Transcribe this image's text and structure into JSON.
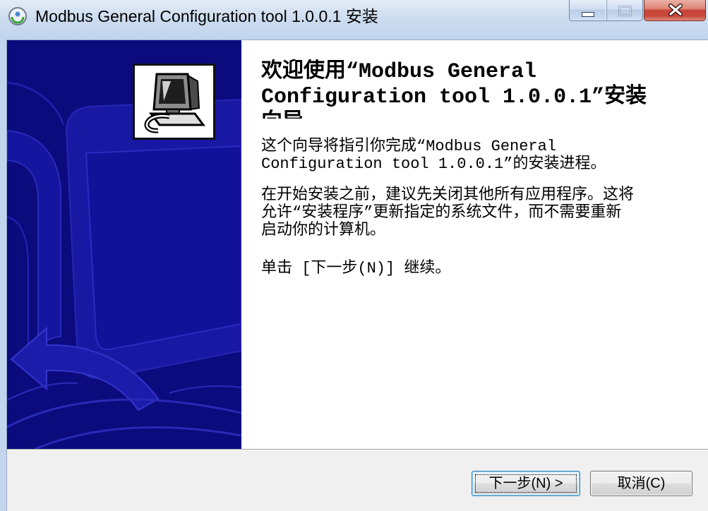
{
  "window": {
    "title": "Modbus General Configuration tool 1.0.0.1 安装",
    "icon": "installer-icon",
    "controls": {
      "minimize": "minimize-icon",
      "maximize": "maximize-icon",
      "close": "close-icon"
    },
    "maximize_enabled": false
  },
  "sidebar": {
    "icon": "computer-setup-icon"
  },
  "welcome": {
    "heading_lines": [
      "欢迎使用“Modbus General",
      "Configuration tool 1.0.0.1”安装",
      "向导"
    ],
    "paragraphs": [
      [
        "这个向导将指引你完成“Modbus General",
        "Configuration tool 1.0.0.1”的安装进程。"
      ],
      [
        "在开始安装之前，建议先关闭其他所有应用程序。这将",
        "允许“安装程序”更新指定的系统文件，而不需要重新",
        "启动你的计算机。"
      ],
      [
        "单击 [下一步(N)] 继续。"
      ]
    ]
  },
  "buttons": {
    "next": {
      "label": "下一步(N) >",
      "is_default": true,
      "focused": true
    },
    "cancel": {
      "label": "取消(C)"
    }
  },
  "colors": {
    "frame": "#c2d5ed",
    "title_bar": "#c0d4ec",
    "close_button": "#c8463a",
    "sidebar_background": "#0b0b7e",
    "content_background": "#ffffff",
    "button_area": "#f0f0f0",
    "default_button_border": "#3c7fb1"
  }
}
